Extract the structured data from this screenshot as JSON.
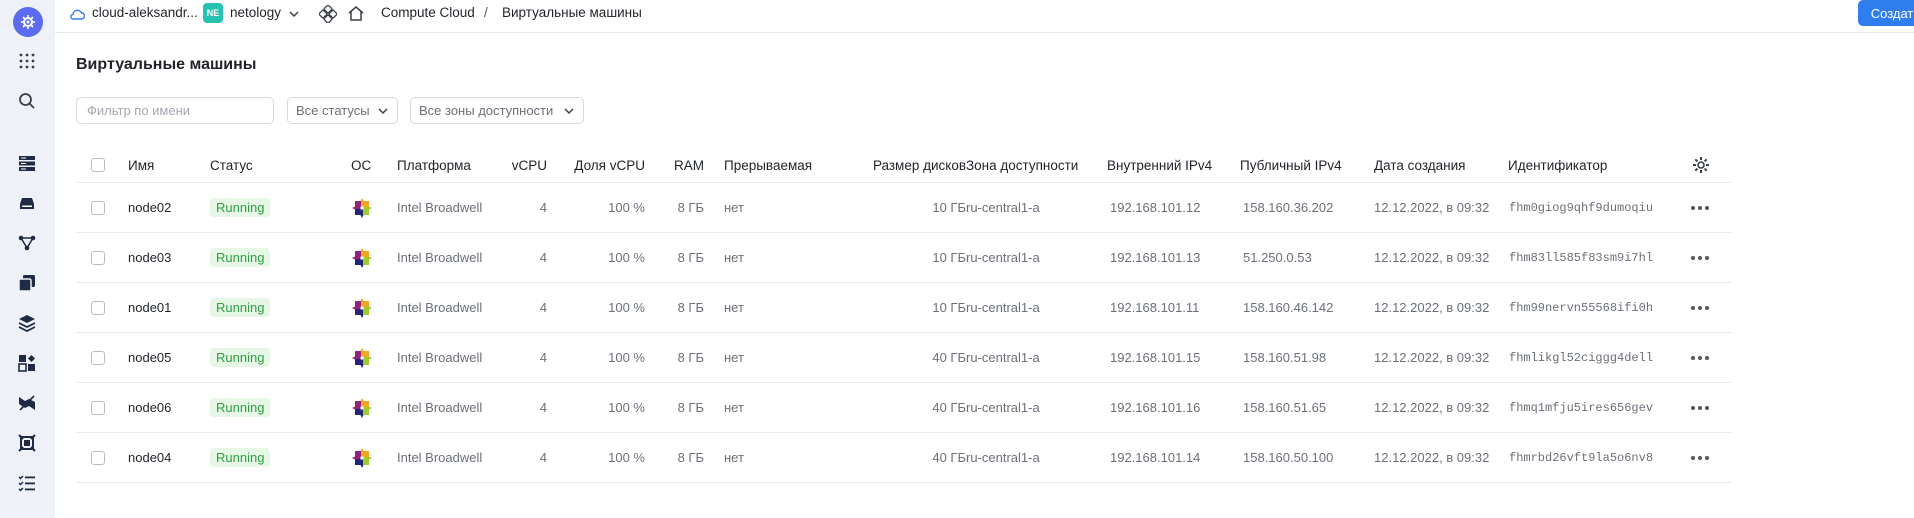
{
  "topbar": {
    "cloud_name": "cloud-aleksandr...",
    "folder_badge": "NE",
    "folder_name": "netology",
    "breadcrumb_service": "Compute Cloud",
    "breadcrumb_separator": "/",
    "breadcrumb_page": "Виртуальные машины",
    "create_button": "Создать ВМ"
  },
  "page": {
    "title": "Виртуальные машины"
  },
  "filters": {
    "name_placeholder": "Фильтр по имени",
    "status_select": "Все статусы",
    "zone_select": "Все зоны доступности"
  },
  "table": {
    "columns": {
      "name": "Имя",
      "status": "Статус",
      "os": "ОС",
      "platform": "Платформа",
      "vcpu": "vCPU",
      "vcpu_share": "Доля vCPU",
      "ram": "RAM",
      "preemptible": "Прерываемая",
      "disk_size": "Размер дисков",
      "zone": "Зона доступности",
      "internal_ip": "Внутренний IPv4",
      "public_ip": "Публичный IPv4",
      "created": "Дата создания",
      "id": "Идентификатор"
    },
    "rows": [
      {
        "name": "node02",
        "status": "Running",
        "platform": "Intel Broadwell",
        "vcpu": "4",
        "vcpu_share": "100 %",
        "ram": "8 ГБ",
        "preemptible": "нет",
        "disk_size": "10 ГБ",
        "zone": "ru-central1-a",
        "internal_ip": "192.168.101.12",
        "public_ip": "158.160.36.202",
        "created": "12.12.2022, в 09:32",
        "id": "fhm0giog9qhf9dumoqiu"
      },
      {
        "name": "node03",
        "status": "Running",
        "platform": "Intel Broadwell",
        "vcpu": "4",
        "vcpu_share": "100 %",
        "ram": "8 ГБ",
        "preemptible": "нет",
        "disk_size": "10 ГБ",
        "zone": "ru-central1-a",
        "internal_ip": "192.168.101.13",
        "public_ip": "51.250.0.53",
        "created": "12.12.2022, в 09:32",
        "id": "fhm83ll585f83sm9i7hl"
      },
      {
        "name": "node01",
        "status": "Running",
        "platform": "Intel Broadwell",
        "vcpu": "4",
        "vcpu_share": "100 %",
        "ram": "8 ГБ",
        "preemptible": "нет",
        "disk_size": "10 ГБ",
        "zone": "ru-central1-a",
        "internal_ip": "192.168.101.11",
        "public_ip": "158.160.46.142",
        "created": "12.12.2022, в 09:32",
        "id": "fhm99nervn55568ifi0h"
      },
      {
        "name": "node05",
        "status": "Running",
        "platform": "Intel Broadwell",
        "vcpu": "4",
        "vcpu_share": "100 %",
        "ram": "8 ГБ",
        "preemptible": "нет",
        "disk_size": "40 ГБ",
        "zone": "ru-central1-a",
        "internal_ip": "192.168.101.15",
        "public_ip": "158.160.51.98",
        "created": "12.12.2022, в 09:32",
        "id": "fhmlikgl52ciggg4dell"
      },
      {
        "name": "node06",
        "status": "Running",
        "platform": "Intel Broadwell",
        "vcpu": "4",
        "vcpu_share": "100 %",
        "ram": "8 ГБ",
        "preemptible": "нет",
        "disk_size": "40 ГБ",
        "zone": "ru-central1-a",
        "internal_ip": "192.168.101.16",
        "public_ip": "158.160.51.65",
        "created": "12.12.2022, в 09:32",
        "id": "fhmq1mfju5ires656gev"
      },
      {
        "name": "node04",
        "status": "Running",
        "platform": "Intel Broadwell",
        "vcpu": "4",
        "vcpu_share": "100 %",
        "ram": "8 ГБ",
        "preemptible": "нет",
        "disk_size": "40 ГБ",
        "zone": "ru-central1-a",
        "internal_ip": "192.168.101.14",
        "public_ip": "158.160.50.100",
        "created": "12.12.2022, в 09:32",
        "id": "fhmrbd26vft9la5o6nv8"
      }
    ]
  },
  "icons": {
    "sidebar": [
      "services-grid-icon",
      "search-icon",
      "compute-icon",
      "storage-icon",
      "network-icon",
      "copy-icon",
      "layers-icon",
      "marketplace-icon",
      "monitoring-icon",
      "frame-icon",
      "checklist-icon"
    ],
    "os": "centos-icon",
    "row_menu": "more-dots-icon",
    "settings": "gear-icon"
  },
  "colors": {
    "accent": "#2f7ef0",
    "logo": "#5b6cf0",
    "running_text": "#2f9e44",
    "running_bg": "#e6f7e6",
    "folder_badge": "#27c1b3"
  }
}
